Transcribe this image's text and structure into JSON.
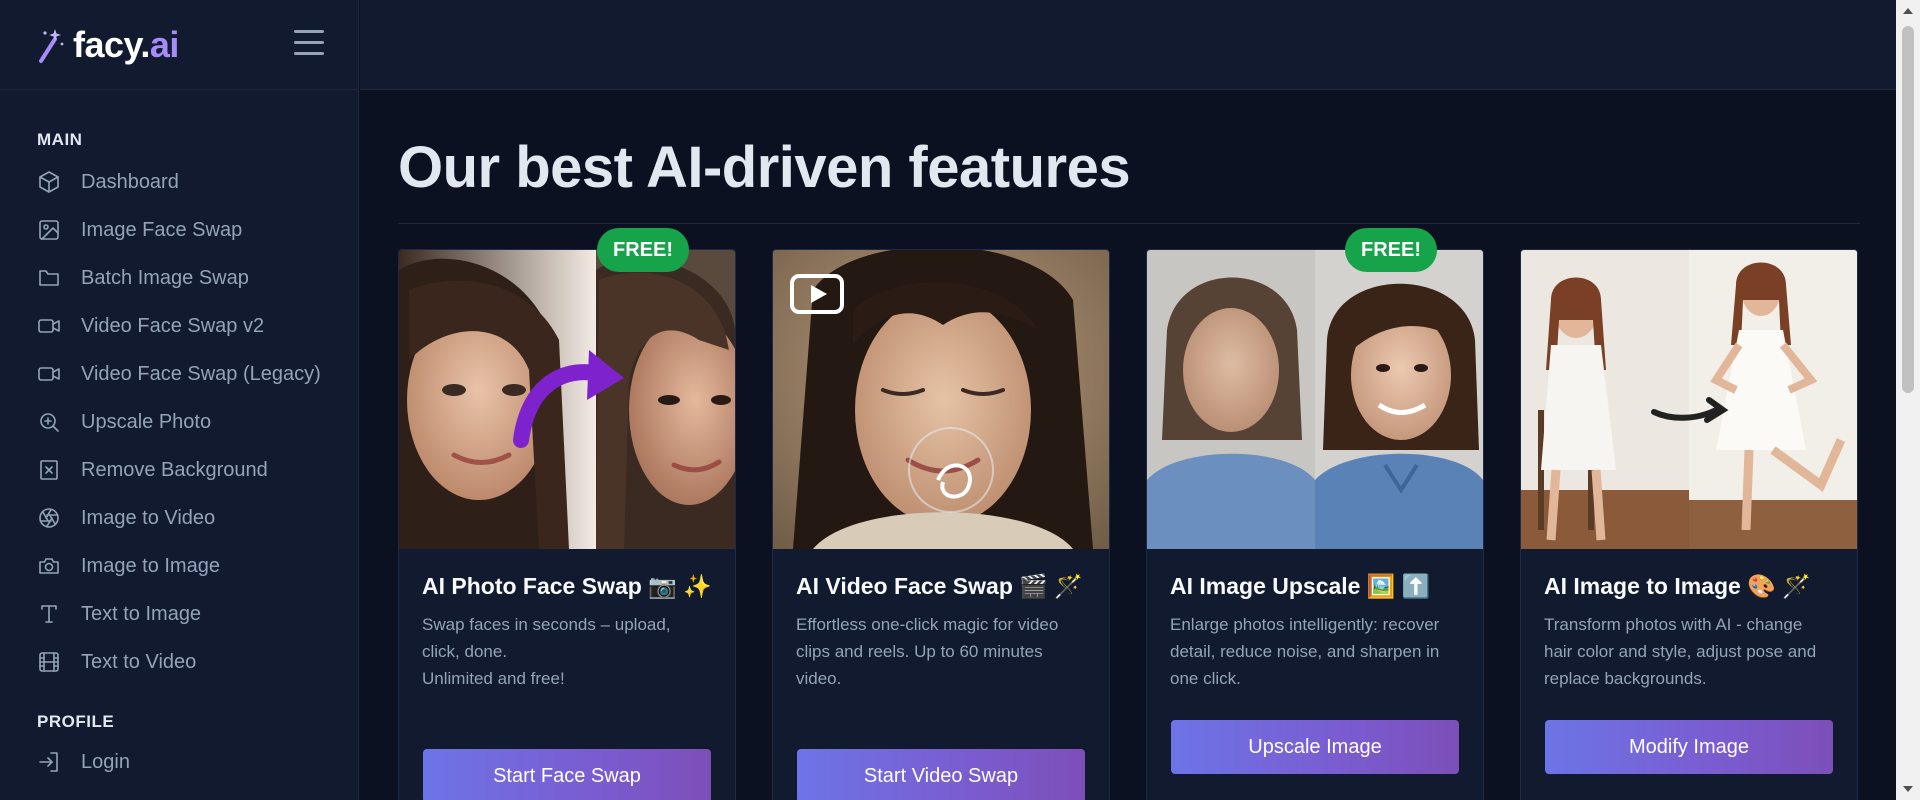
{
  "brand": {
    "name": "facy",
    "dot": ".",
    "suffix": "ai"
  },
  "sidebar": {
    "main_title": "MAIN",
    "profile_title": "PROFILE",
    "items": [
      {
        "label": "Dashboard",
        "icon": "cube-icon"
      },
      {
        "label": "Image Face Swap",
        "icon": "image-icon"
      },
      {
        "label": "Batch Image Swap",
        "icon": "folder-icon"
      },
      {
        "label": "Video Face Swap v2",
        "icon": "video-camera-icon"
      },
      {
        "label": "Video Face Swap (Legacy)",
        "icon": "video-camera-icon"
      },
      {
        "label": "Upscale Photo",
        "icon": "zoom-in-icon"
      },
      {
        "label": "Remove Background",
        "icon": "x-square-icon"
      },
      {
        "label": "Image to Video",
        "icon": "aperture-icon"
      },
      {
        "label": "Image to Image",
        "icon": "camera-icon"
      },
      {
        "label": "Text to Image",
        "icon": "type-icon"
      },
      {
        "label": "Text to Video",
        "icon": "film-icon"
      }
    ],
    "profile_items": [
      {
        "label": "Login",
        "icon": "login-icon"
      }
    ]
  },
  "main": {
    "title": "Our best AI-driven features",
    "badge_label": "FREE!",
    "cards": [
      {
        "title": "AI Photo Face Swap 📷 ✨",
        "desc": [
          "Swap faces in seconds – upload, click, done.",
          "Unlimited and free!"
        ],
        "button": "Start Face Swap",
        "free": true
      },
      {
        "title": "AI Video Face Swap 🎬 🪄",
        "desc": [
          "Effortless one-click magic for video clips and reels. Up to 60 minutes video."
        ],
        "button": "Start Video Swap",
        "free": false
      },
      {
        "title": "AI Image Upscale 🖼️ ⬆️",
        "desc": [
          "Enlarge photos intelligently: recover detail, reduce noise, and sharpen in one click."
        ],
        "button": "Upscale Image",
        "free": true
      },
      {
        "title": "AI Image to Image 🎨 🪄",
        "desc": [
          "Transform photos with AI - change hair color and style, adjust pose and replace backgrounds."
        ],
        "button": "Modify Image",
        "free": false
      }
    ]
  },
  "colors": {
    "background": "#0b1120",
    "sidebar": "#111a2e",
    "accent_purple": "#a78bfa",
    "free_badge": "#16a34a",
    "button_gradient_start": "#6d74e6",
    "button_gradient_end": "#7c4fb8"
  }
}
